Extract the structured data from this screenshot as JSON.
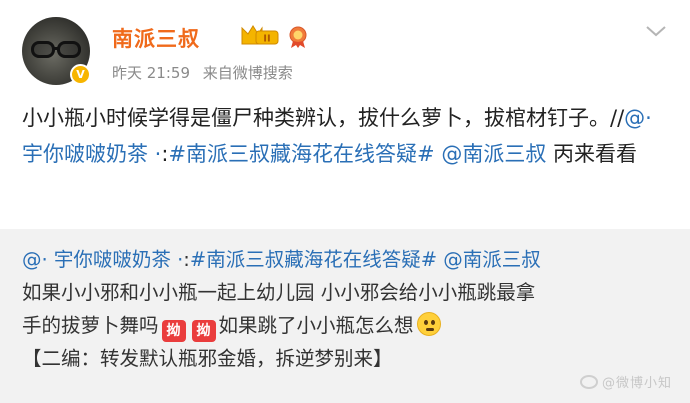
{
  "user": {
    "name": "南派三叔",
    "level_badge": "II",
    "verified_icon": "v-icon"
  },
  "meta": {
    "time": "昨天 21:59",
    "source": "来自微博搜索"
  },
  "post": {
    "text_part1": "小小瓶小时候学得是僵尸种类辨认，拔什么萝卜，拔棺材钉子。//",
    "mention1": "@· 宇你啵啵奶茶 ·",
    "sep1": ":",
    "hashtag": "#南派三叔藏海花在线答疑#",
    "sep2": " ",
    "mention2": "@南派三叔",
    "text_part2": " 丙来看看"
  },
  "repost": {
    "mention1": "@· 宇你啵啵奶茶 ·",
    "sep1": ":",
    "hashtag": "#南派三叔藏海花在线答疑#",
    "sep2": " ",
    "mention2": "@南派三叔",
    "line2": "如果小小邪和小小瓶一起上幼儿园 小小邪会给小小瓶跳最拿",
    "line3_part1": "手的拔萝卜舞吗",
    "emoji_label": "拗",
    "line3_part2": "如果跳了小小瓶怎么想",
    "line4": "【二编：转发默认瓶邪金婚，拆逆梦别来】"
  },
  "watermark": {
    "text": "@微博小知"
  },
  "colors": {
    "name": "#f06a1b",
    "link": "#2a6fb6",
    "meta": "#8a8a8a",
    "repost_bg": "#f2f2f2"
  }
}
